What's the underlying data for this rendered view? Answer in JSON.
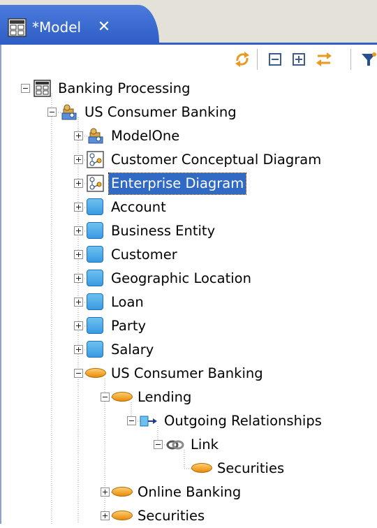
{
  "tab": {
    "title": "*Model",
    "close_glyph": "✕",
    "icon": "model-icon"
  },
  "toolbar": {
    "buttons": [
      {
        "name": "sync-icon"
      },
      {
        "name": "collapse-all-icon"
      },
      {
        "name": "expand-all-icon"
      },
      {
        "name": "link-with-editor-icon"
      },
      {
        "name": "filter-icon"
      }
    ]
  },
  "tree": {
    "selected_index": 3,
    "nodes": [
      {
        "label": "Banking Processing",
        "icon": "model-icon",
        "level": 0,
        "expander": "minus"
      },
      {
        "label": "US Consumer Banking",
        "icon": "package-icon",
        "level": 1,
        "expander": "minus"
      },
      {
        "label": "ModelOne",
        "icon": "package-icon",
        "level": 2,
        "expander": "plus"
      },
      {
        "label": "Customer Conceptual Diagram",
        "icon": "diagram-icon",
        "level": 2,
        "expander": "plus"
      },
      {
        "label": "Enterprise Diagram",
        "icon": "diagram-icon",
        "level": 2,
        "expander": "plus"
      },
      {
        "label": "Account",
        "icon": "entity-icon",
        "level": 2,
        "expander": "plus"
      },
      {
        "label": "Business Entity",
        "icon": "entity-icon",
        "level": 2,
        "expander": "plus"
      },
      {
        "label": "Customer",
        "icon": "entity-icon",
        "level": 2,
        "expander": "plus"
      },
      {
        "label": "Geographic Location",
        "icon": "entity-icon",
        "level": 2,
        "expander": "plus"
      },
      {
        "label": "Loan",
        "icon": "entity-icon",
        "level": 2,
        "expander": "plus"
      },
      {
        "label": "Party",
        "icon": "entity-icon",
        "level": 2,
        "expander": "plus"
      },
      {
        "label": "Salary",
        "icon": "entity-icon",
        "level": 2,
        "expander": "plus"
      },
      {
        "label": "US Consumer Banking",
        "icon": "subject-area-icon",
        "level": 2,
        "expander": "minus"
      },
      {
        "label": "Lending",
        "icon": "subject-area-icon",
        "level": 3,
        "expander": "minus"
      },
      {
        "label": "Outgoing Relationships",
        "icon": "outgoing-relationships-icon",
        "level": 4,
        "expander": "minus"
      },
      {
        "label": "Link",
        "icon": "link-icon",
        "level": 5,
        "expander": "minus"
      },
      {
        "label": "Securities",
        "icon": "subject-area-icon",
        "level": 6,
        "expander": "none"
      },
      {
        "label": "Online Banking",
        "icon": "subject-area-icon",
        "level": 3,
        "expander": "plus"
      },
      {
        "label": "Securities",
        "icon": "subject-area-icon",
        "level": 3,
        "expander": "plus"
      }
    ]
  },
  "colors": {
    "tab_blue": "#2f5fc6",
    "selection": "#316ac5",
    "tree_line": "#9a9a9a"
  }
}
